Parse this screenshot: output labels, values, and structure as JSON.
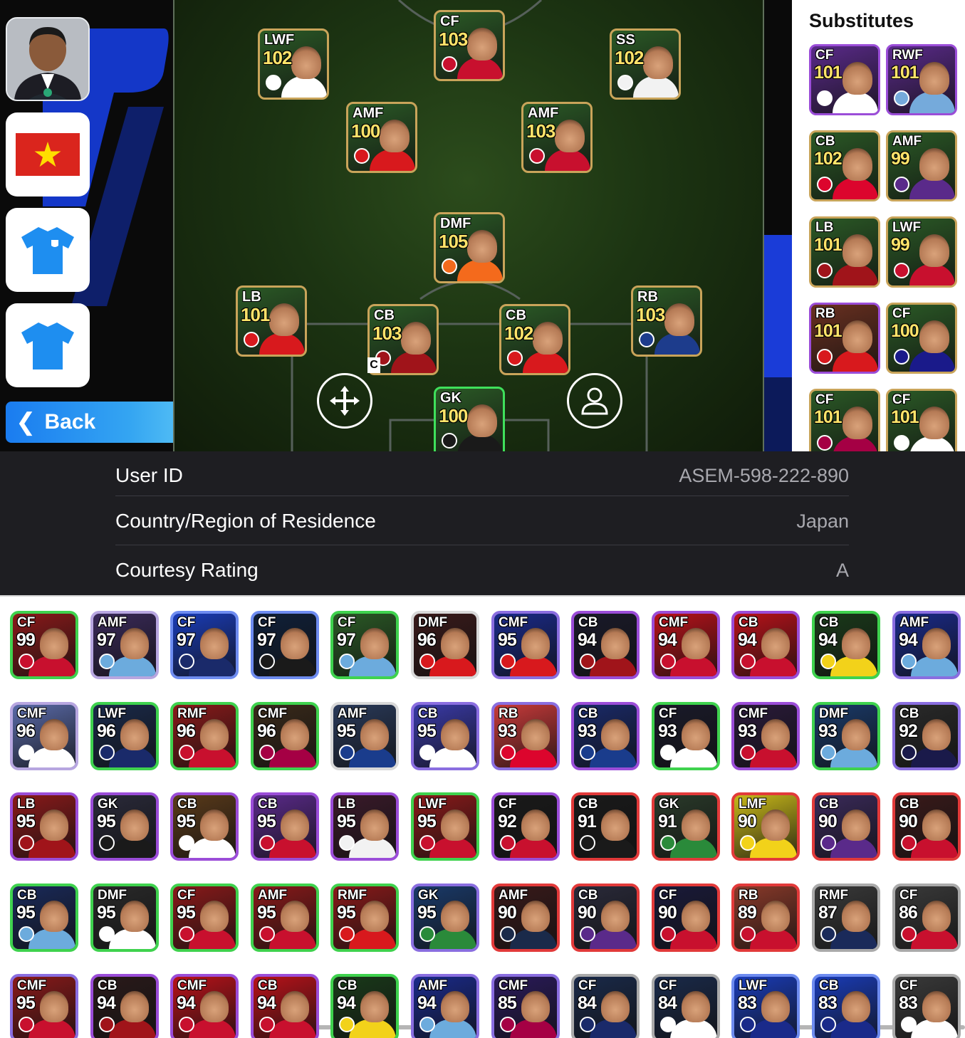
{
  "sidebar": {
    "manager": "manager-photo",
    "flag": "vietnam-flag",
    "kit_home": "home-kit-icon",
    "kit_away": "away-kit-icon",
    "back_label": "Back"
  },
  "formation": {
    "players": [
      {
        "pos": "LWF",
        "rating": "102",
        "frame": "#c9a45a",
        "bg": "#2b5a26",
        "kit": "#ffffff"
      },
      {
        "pos": "CF",
        "rating": "103",
        "frame": "#c9a45a",
        "bg": "#2b5a26",
        "kit": "#c8102e"
      },
      {
        "pos": "SS",
        "rating": "102",
        "frame": "#c9a45a",
        "bg": "#2b5a26",
        "kit": "#f2f2f2"
      },
      {
        "pos": "AMF",
        "rating": "100",
        "frame": "#c9a45a",
        "bg": "#2b5a26",
        "kit": "#d8191d"
      },
      {
        "pos": "AMF",
        "rating": "103",
        "frame": "#c9a45a",
        "bg": "#2b5a26",
        "kit": "#c8102e"
      },
      {
        "pos": "DMF",
        "rating": "105",
        "frame": "#c9a45a",
        "bg": "#2b5a26",
        "kit": "#f46a1c"
      },
      {
        "pos": "LB",
        "rating": "101",
        "frame": "#c9a45a",
        "bg": "#2b5a26",
        "kit": "#d8191d"
      },
      {
        "pos": "CB",
        "rating": "103",
        "frame": "#c9a45a",
        "bg": "#2b5a26",
        "kit": "#a0141a"
      },
      {
        "pos": "CB",
        "rating": "102",
        "frame": "#c9a45a",
        "bg": "#2b5a26",
        "kit": "#d8191d"
      },
      {
        "pos": "RB",
        "rating": "103",
        "frame": "#c9a45a",
        "bg": "#2b5a26",
        "kit": "#1d3c8c"
      },
      {
        "pos": "GK",
        "rating": "100",
        "frame": "#3fe05b",
        "bg": "#2b5a26",
        "kit": "#1a1a1a"
      }
    ],
    "captain_label": "C",
    "move_icon": "move-icon",
    "profile_icon": "person-icon"
  },
  "substitutes": {
    "title": "Substitutes",
    "players": [
      {
        "pos": "CF",
        "rating": "101",
        "frame": "#9b4dd8",
        "bg": "#5a2a8a",
        "kit": "#ffffff"
      },
      {
        "pos": "RWF",
        "rating": "101",
        "frame": "#9b4dd8",
        "bg": "#5a2a8a",
        "kit": "#75aadb"
      },
      {
        "pos": "CB",
        "rating": "102",
        "frame": "#c9a45a",
        "bg": "#2b5a26",
        "kit": "#dc052d"
      },
      {
        "pos": "AMF",
        "rating": "99",
        "frame": "#c9a45a",
        "bg": "#2b5a26",
        "kit": "#5a2a8a"
      },
      {
        "pos": "LB",
        "rating": "101",
        "frame": "#c9a45a",
        "bg": "#2b5a26",
        "kit": "#a0141a"
      },
      {
        "pos": "LWF",
        "rating": "99",
        "frame": "#c9a45a",
        "bg": "#2b5a26",
        "kit": "#c8102e"
      },
      {
        "pos": "RB",
        "rating": "101",
        "frame": "#9b4dd8",
        "bg": "#6a3020",
        "kit": "#d8191d"
      },
      {
        "pos": "CF",
        "rating": "100",
        "frame": "#c9a45a",
        "bg": "#2b5a26",
        "kit": "#1a1a8a"
      },
      {
        "pos": "CF",
        "rating": "101",
        "frame": "#c9a45a",
        "bg": "#2b5a26",
        "kit": "#a50044"
      },
      {
        "pos": "CF",
        "rating": "101",
        "frame": "#c9a45a",
        "bg": "#2b5a26",
        "kit": "#ffffff"
      }
    ]
  },
  "profile": {
    "rows": [
      {
        "label": "User ID",
        "value": "ASEM-598-222-890"
      },
      {
        "label": "Country/Region of Residence",
        "value": "Japan"
      },
      {
        "label": "Courtesy Rating",
        "value": "A"
      }
    ]
  },
  "collection": {
    "rows": [
      [
        {
          "pos": "CF",
          "rating": "99",
          "frame": "#3fd24e",
          "bg": "#8a1a1a",
          "kit": "#c8102e"
        },
        {
          "pos": "AMF",
          "rating": "97",
          "frame": "#b7a6e0",
          "bg": "#3a2a5a",
          "kit": "#6cabdd"
        },
        {
          "pos": "CF",
          "rating": "97",
          "frame": "#6e8cf0",
          "bg": "#1a3cb8",
          "kit": "#1a2a6a"
        },
        {
          "pos": "CF",
          "rating": "97",
          "frame": "#6e8cf0",
          "bg": "#10203a",
          "kit": "#1a1a1a"
        },
        {
          "pos": "CF",
          "rating": "97",
          "frame": "#3fd24e",
          "bg": "#2b5a26",
          "kit": "#6cabdd"
        },
        {
          "pos": "DMF",
          "rating": "96",
          "frame": "#d8d8d8",
          "bg": "#3a1a1a",
          "kit": "#d8191d"
        },
        {
          "pos": "CMF",
          "rating": "95",
          "frame": "#8a6ee0",
          "bg": "#1a2a8a",
          "kit": "#d8191d"
        },
        {
          "pos": "CB",
          "rating": "94",
          "frame": "#9b4dd8",
          "bg": "#1a1a2a",
          "kit": "#a0141a"
        },
        {
          "pos": "CMF",
          "rating": "94",
          "frame": "#9b4dd8",
          "bg": "#b8121a",
          "kit": "#c8102e"
        },
        {
          "pos": "CB",
          "rating": "94",
          "frame": "#9b4dd8",
          "bg": "#b8121a",
          "kit": "#c8102e"
        },
        {
          "pos": "CB",
          "rating": "94",
          "frame": "#3fd24e",
          "bg": "#1a3a1a",
          "kit": "#f2d21a"
        },
        {
          "pos": "AMF",
          "rating": "94",
          "frame": "#8a6ee0",
          "bg": "#1a2a8a",
          "kit": "#6cabdd"
        }
      ],
      [
        {
          "pos": "CMF",
          "rating": "96",
          "frame": "#b7a6e0",
          "bg": "#5a6aa8",
          "kit": "#ffffff"
        },
        {
          "pos": "LWF",
          "rating": "96",
          "frame": "#3fd24e",
          "bg": "#1a2a4a",
          "kit": "#1a2a6a"
        },
        {
          "pos": "RMF",
          "rating": "96",
          "frame": "#3fd24e",
          "bg": "#8a1a1a",
          "kit": "#c8102e"
        },
        {
          "pos": "CMF",
          "rating": "96",
          "frame": "#3fd24e",
          "bg": "#3a2a1a",
          "kit": "#a50044"
        },
        {
          "pos": "AMF",
          "rating": "95",
          "frame": "#d8d8d8",
          "bg": "#2a3a5a",
          "kit": "#1a3c8c"
        },
        {
          "pos": "CB",
          "rating": "95",
          "frame": "#8a6ee0",
          "bg": "#3a3aa8",
          "kit": "#ffffff"
        },
        {
          "pos": "RB",
          "rating": "93",
          "frame": "#8a6ee0",
          "bg": "#c83a3a",
          "kit": "#dc052d"
        },
        {
          "pos": "CB",
          "rating": "93",
          "frame": "#9b4dd8",
          "bg": "#1a2a6a",
          "kit": "#1a3c8c"
        },
        {
          "pos": "CF",
          "rating": "93",
          "frame": "#3fd24e",
          "bg": "#1a1a2a",
          "kit": "#ffffff"
        },
        {
          "pos": "CMF",
          "rating": "93",
          "frame": "#9b4dd8",
          "bg": "#2a1a3a",
          "kit": "#c8102e"
        },
        {
          "pos": "DMF",
          "rating": "93",
          "frame": "#3fd24e",
          "bg": "#1a3a6a",
          "kit": "#6cabdd"
        },
        {
          "pos": "CB",
          "rating": "92",
          "frame": "#8a6ee0",
          "bg": "#2a2a2a",
          "kit": "#1a1a4a"
        }
      ],
      [
        {
          "pos": "LB",
          "rating": "95",
          "frame": "#9b4dd8",
          "bg": "#8a1a1a",
          "kit": "#a0141a"
        },
        {
          "pos": "GK",
          "rating": "95",
          "frame": "#9b4dd8",
          "bg": "#2a2a3a",
          "kit": "#1a1a1a"
        },
        {
          "pos": "CB",
          "rating": "95",
          "frame": "#9b4dd8",
          "bg": "#5a3a1a",
          "kit": "#ffffff"
        },
        {
          "pos": "CB",
          "rating": "95",
          "frame": "#9b4dd8",
          "bg": "#5a2a8a",
          "kit": "#c8102e"
        },
        {
          "pos": "LB",
          "rating": "95",
          "frame": "#9b4dd8",
          "bg": "#3a1a2a",
          "kit": "#f2f2f2"
        },
        {
          "pos": "LWF",
          "rating": "95",
          "frame": "#3fd24e",
          "bg": "#8a1a1a",
          "kit": "#c8102e"
        },
        {
          "pos": "CF",
          "rating": "92",
          "frame": "#9b4dd8",
          "bg": "#1a1a1a",
          "kit": "#c8102e"
        },
        {
          "pos": "CB",
          "rating": "91",
          "frame": "#e23a3a",
          "bg": "#1a1a1a",
          "kit": "#1a1a1a"
        },
        {
          "pos": "GK",
          "rating": "91",
          "frame": "#e23a3a",
          "bg": "#2a3a2a",
          "kit": "#2a8a3a"
        },
        {
          "pos": "LMF",
          "rating": "90",
          "frame": "#e23a3a",
          "bg": "#c8b81a",
          "kit": "#f2d21a"
        },
        {
          "pos": "CB",
          "rating": "90",
          "frame": "#e23a3a",
          "bg": "#3a2a5a",
          "kit": "#5a2a8a"
        },
        {
          "pos": "CB",
          "rating": "90",
          "frame": "#e23a3a",
          "bg": "#3a1a1a",
          "kit": "#c8102e"
        }
      ],
      [
        {
          "pos": "CB",
          "rating": "95",
          "frame": "#3fd24e",
          "bg": "#1a2a5a",
          "kit": "#6cabdd"
        },
        {
          "pos": "DMF",
          "rating": "95",
          "frame": "#3fd24e",
          "bg": "#2a2a2a",
          "kit": "#ffffff"
        },
        {
          "pos": "CF",
          "rating": "95",
          "frame": "#3fd24e",
          "bg": "#8a1a1a",
          "kit": "#c8102e"
        },
        {
          "pos": "AMF",
          "rating": "95",
          "frame": "#3fd24e",
          "bg": "#8a1a1a",
          "kit": "#c8102e"
        },
        {
          "pos": "RMF",
          "rating": "95",
          "frame": "#3fd24e",
          "bg": "#8a1a1a",
          "kit": "#d8191d"
        },
        {
          "pos": "GK",
          "rating": "95",
          "frame": "#8a6ee0",
          "bg": "#1a3a6a",
          "kit": "#2a8a3a"
        },
        {
          "pos": "AMF",
          "rating": "90",
          "frame": "#e23a3a",
          "bg": "#3a1a1a",
          "kit": "#1a2a4a"
        },
        {
          "pos": "CB",
          "rating": "90",
          "frame": "#e23a3a",
          "bg": "#2a2a3a",
          "kit": "#5a2a8a"
        },
        {
          "pos": "CF",
          "rating": "90",
          "frame": "#e23a3a",
          "bg": "#1a1a3a",
          "kit": "#c8102e"
        },
        {
          "pos": "RB",
          "rating": "89",
          "frame": "#e23a3a",
          "bg": "#8a3a2a",
          "kit": "#c8102e"
        },
        {
          "pos": "RMF",
          "rating": "87",
          "frame": "#aaaaaa",
          "bg": "#3a3a3a",
          "kit": "#1a2a5a"
        },
        {
          "pos": "CF",
          "rating": "86",
          "frame": "#aaaaaa",
          "bg": "#3a3a3a",
          "kit": "#c8102e"
        }
      ],
      [
        {
          "pos": "CMF",
          "rating": "95",
          "frame": "#8a6ee0",
          "bg": "#8a1a1a",
          "kit": "#c8102e"
        },
        {
          "pos": "CB",
          "rating": "94",
          "frame": "#9b4dd8",
          "bg": "#2a1a1a",
          "kit": "#a0141a"
        },
        {
          "pos": "CMF",
          "rating": "94",
          "frame": "#9b4dd8",
          "bg": "#b8121a",
          "kit": "#c8102e"
        },
        {
          "pos": "CB",
          "rating": "94",
          "frame": "#9b4dd8",
          "bg": "#b8121a",
          "kit": "#c8102e"
        },
        {
          "pos": "CB",
          "rating": "94",
          "frame": "#3fd24e",
          "bg": "#1a3a1a",
          "kit": "#f2d21a"
        },
        {
          "pos": "AMF",
          "rating": "94",
          "frame": "#8a6ee0",
          "bg": "#1a2a8a",
          "kit": "#6cabdd"
        },
        {
          "pos": "CMF",
          "rating": "85",
          "frame": "#8a6ee0",
          "bg": "#2a1a5a",
          "kit": "#a50044"
        },
        {
          "pos": "CF",
          "rating": "84",
          "frame": "#aaaaaa",
          "bg": "#1a2a4a",
          "kit": "#1a2a6a"
        },
        {
          "pos": "CF",
          "rating": "84",
          "frame": "#aaaaaa",
          "bg": "#1a2a4a",
          "kit": "#ffffff"
        },
        {
          "pos": "LWF",
          "rating": "83",
          "frame": "#6e8cf0",
          "bg": "#1a3cb8",
          "kit": "#1a2a8a"
        },
        {
          "pos": "CB",
          "rating": "83",
          "frame": "#6e8cf0",
          "bg": "#1a3cb8",
          "kit": "#1a2a8a"
        },
        {
          "pos": "CF",
          "rating": "83",
          "frame": "#aaaaaa",
          "bg": "#3a3a3a",
          "kit": "#ffffff"
        }
      ]
    ]
  }
}
